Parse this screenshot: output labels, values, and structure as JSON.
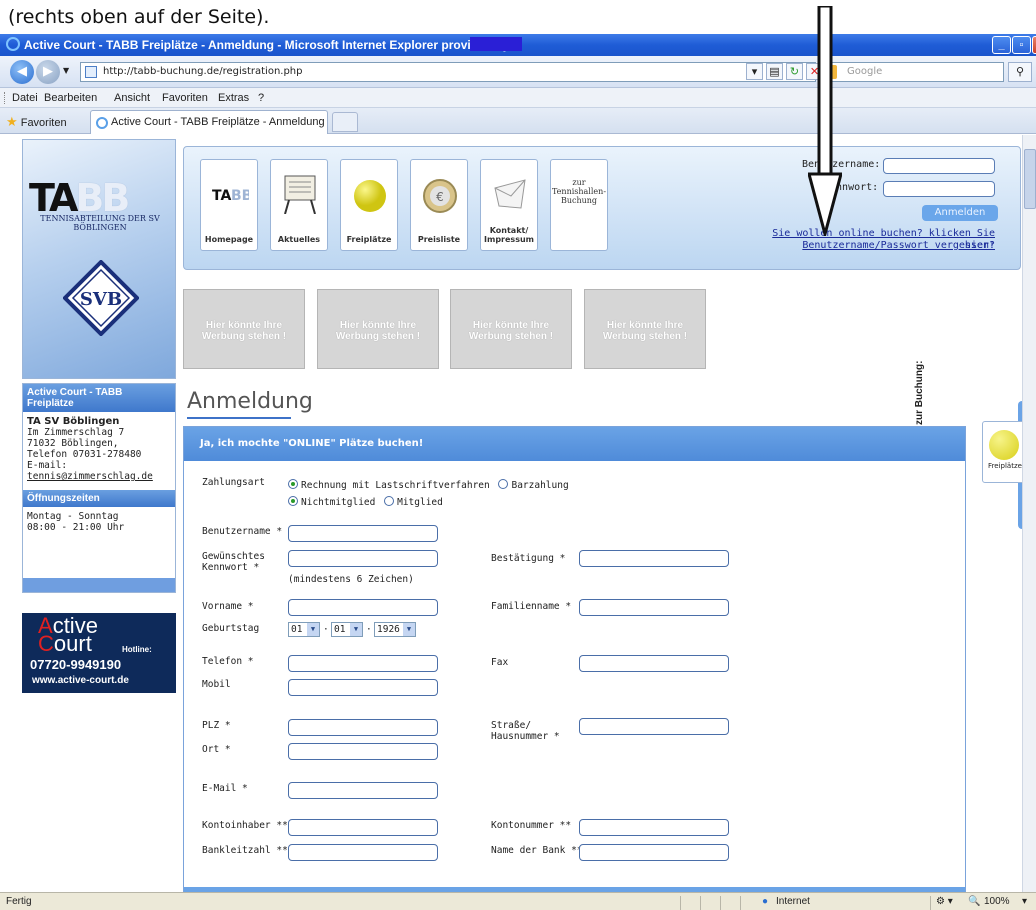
{
  "annotation": {
    "caption": "(rechts oben auf der Seite)."
  },
  "window": {
    "title": "Active Court - TABB Freiplätze - Anmeldung - Microsoft Internet Explorer provided by"
  },
  "address": {
    "url": "http://tabb-buchung.de/registration.php",
    "search_placeholder": "Google"
  },
  "menu": [
    "Datei",
    "Bearbeiten",
    "Ansicht",
    "Favoriten",
    "Extras",
    "?"
  ],
  "tabs": {
    "favorites": "Favoriten",
    "active_tab": "Active Court - TABB Freiplätze - Anmeldung"
  },
  "logo": {
    "letters": "TA",
    "letters2": "BB",
    "subtitle": "TENNISABTEILUNG DER SV BÖBLINGEN",
    "emblem": "SVB"
  },
  "nav": {
    "items": [
      {
        "label": "Homepage",
        "icon": "tabb-logo-icon"
      },
      {
        "label": "Aktuelles",
        "icon": "board-icon"
      },
      {
        "label": "Freiplätze",
        "icon": "tennis-ball-icon"
      },
      {
        "label": "Preisliste",
        "icon": "euro-coin-icon"
      },
      {
        "label": "Kontakt/ Impressum",
        "icon": "envelope-icon"
      },
      {
        "label": "zur Tennishallen- Buchung",
        "icon": ""
      }
    ]
  },
  "login": {
    "username_label": "Benutzername:",
    "password_label": "Kennwort:",
    "submit": "Anmelden",
    "online_link": "Sie wollen online buchen? klicken Sie hier!",
    "forgot_link": "Benutzername/Passwort vergessen?"
  },
  "ads": [
    "Hier könnte Ihre Werbung stehen !",
    "Hier könnte Ihre Werbung stehen !",
    "Hier könnte Ihre Werbung stehen !",
    "Hier könnte Ihre Werbung stehen !"
  ],
  "sidebar": {
    "box_title": "Active Court - TABB Freiplätze",
    "org": "TA SV Böblingen",
    "street": "Im Zimmerschlag 7",
    "city": "71032 Böblingen,",
    "phone": "Telefon 07031-278480",
    "email_label": "E-mail:",
    "email": "tennis@zimmerschlag.de",
    "hours_title": "Öffnungszeiten",
    "hours_days": "Montag - Sonntag",
    "hours_time": "08:00 - 21:00 Uhr"
  },
  "banner": {
    "word1": "ctive",
    "letter1": "A",
    "word2": "ourt",
    "letter2": "C",
    "hotline": "Hotline:",
    "phone": "07720-9949190",
    "web": "www.active-court.de"
  },
  "page": {
    "heading": "Anmeldung"
  },
  "form": {
    "header": "Ja, ich mochte \"ONLINE\" Plätze buchen!",
    "zahlungsart_label": "Zahlungsart",
    "pay_option1": "Rechnung mit Lastschriftverfahren",
    "pay_option2": "Barzahlung",
    "member_option1": "Nichtmitglied",
    "member_option2": "Mitglied",
    "benutzername": "Benutzername *",
    "kennwort": "Gewünschtes Kennwort *",
    "kennwort_hint": "(mindestens 6 Zeichen)",
    "bestaetigung": "Bestätigung *",
    "vorname": "Vorname *",
    "familienname": "Familienname *",
    "geburtstag": "Geburtstag",
    "birth_day": "01",
    "birth_month": "01",
    "birth_year": "1926",
    "telefon": "Telefon *",
    "fax": "Fax",
    "mobil": "Mobil",
    "plz": "PLZ *",
    "strasse": "Straße/ Hausnummer *",
    "ort": "Ort *",
    "email": "E-Mail *",
    "kontoinhaber": "Kontoinhaber **",
    "kontonummer": "Kontonummer **",
    "bankleitzahl": "Bankleitzahl **",
    "bankname": "Name der Bank **"
  },
  "booking_side": {
    "vertical_label": "zur Buchung:",
    "card_label": "Freiplätze"
  },
  "status": {
    "left": "Fertig",
    "zone": "Internet",
    "zoom": "100%"
  }
}
